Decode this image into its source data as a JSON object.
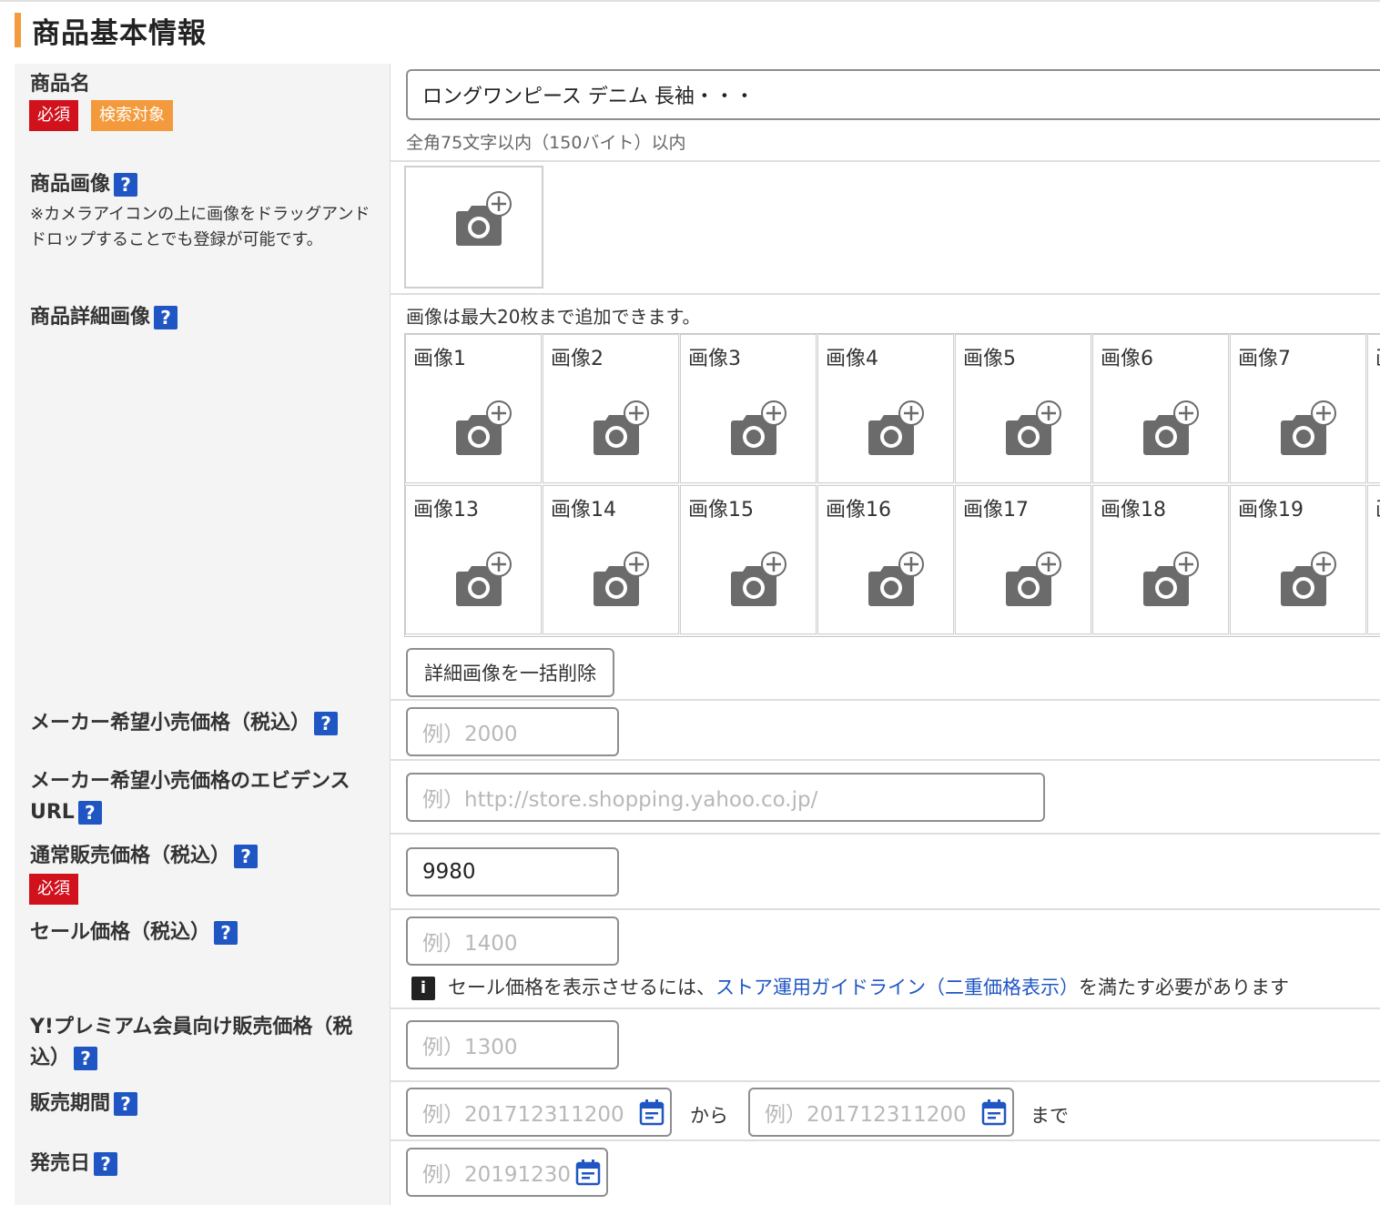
{
  "section": {
    "title": "商品基本情報"
  },
  "product_name": {
    "label": "商品名",
    "badge_required": "必須",
    "badge_search": "検索対象",
    "value": "ロングワンピース デニム 長袖・・・",
    "hint": "全角75文字以内（150バイト）以内"
  },
  "product_image": {
    "label": "商品画像",
    "help": "?",
    "note": "※カメラアイコンの上に画像をドラッグアンドドロップすることでも登録が可能です。"
  },
  "detail_images": {
    "label": "商品詳細画像",
    "help": "?",
    "info": "画像は最大20枚まで追加できます。",
    "row1": [
      "画像1",
      "画像2",
      "画像3",
      "画像4",
      "画像5",
      "画像6",
      "画像7",
      "画"
    ],
    "row2": [
      "画像13",
      "画像14",
      "画像15",
      "画像16",
      "画像17",
      "画像18",
      "画像19",
      "画"
    ],
    "delete_all_label": "詳細画像を一括削除"
  },
  "maker_price": {
    "label": "メーカー希望小売価格（税込）",
    "help": "?",
    "placeholder": "例）2000"
  },
  "maker_url": {
    "label_line1": "メーカー希望小売価格のエビデンス",
    "label_line2": "URL",
    "help": "?",
    "placeholder": "例）http://store.shopping.yahoo.co.jp/"
  },
  "normal_price": {
    "label": "通常販売価格（税込）",
    "help": "?",
    "badge_required": "必須",
    "value": "9980"
  },
  "sale_price": {
    "label": "セール価格（税込）",
    "help": "?",
    "placeholder": "例）1400",
    "info_icon": "i",
    "info_prefix": "セール価格を表示させるには、",
    "info_link": "ストア運用ガイドライン（二重価格表示）",
    "info_suffix": "を満たす必要があります"
  },
  "premium_price": {
    "label_line1": "Y!プレミアム会員向け販売価格（税",
    "label_line2": "込）",
    "help": "?",
    "placeholder": "例）1300"
  },
  "sale_period": {
    "label": "販売期間",
    "help": "?",
    "from_placeholder": "例）201712311200",
    "from_text": "から",
    "to_placeholder": "例）201712311200",
    "to_text": "まで"
  },
  "release_date": {
    "label": "発売日",
    "help": "?",
    "placeholder": "例）20191230"
  },
  "colors": {
    "accent": "#f39a3c",
    "required": "#d1121d",
    "help": "#1f56c4",
    "label_bg": "#f4f4f4"
  },
  "icons": {
    "camera": "camera-add-icon",
    "calendar": "calendar-icon",
    "help": "help-icon",
    "info": "info-icon"
  }
}
